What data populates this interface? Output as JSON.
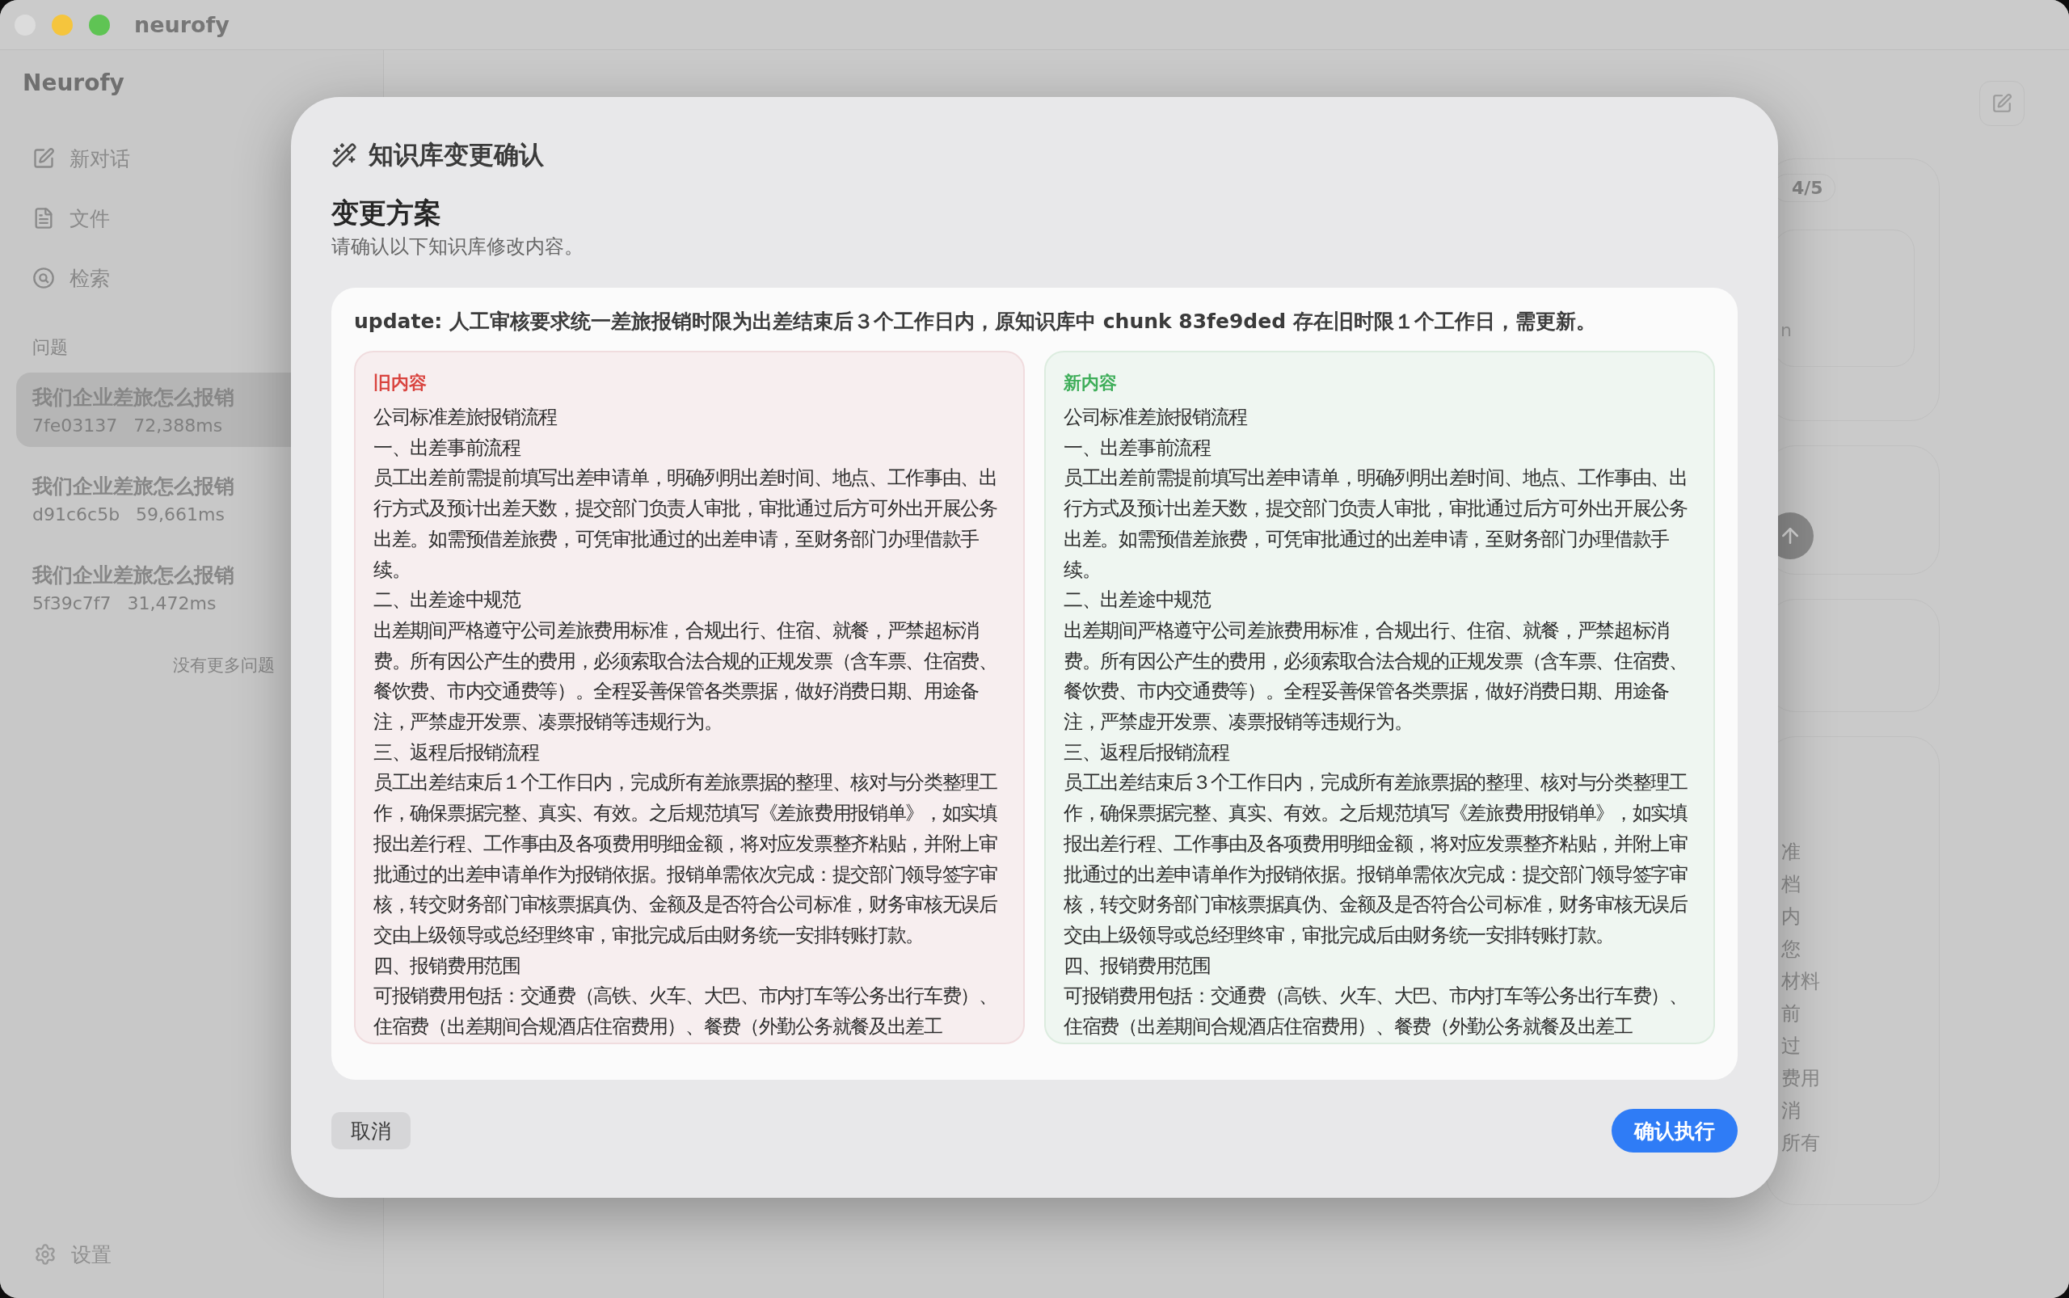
{
  "window": {
    "title": "neurofy"
  },
  "sidebar": {
    "brand": "Neurofy",
    "nav": [
      {
        "label": "新对话"
      },
      {
        "label": "文件"
      },
      {
        "label": "检索"
      }
    ],
    "section_label": "问题",
    "questions": [
      {
        "title": "我们企业差旅怎么报销",
        "id": "7fe03137",
        "duration": "72,388ms",
        "selected": true
      },
      {
        "title": "我们企业差旅怎么报销",
        "id": "d91c6c5b",
        "duration": "59,661ms",
        "selected": false
      },
      {
        "title": "我们企业差旅怎么报销",
        "id": "5f39c7f7",
        "duration": "31,472ms",
        "selected": false
      }
    ],
    "end_note": "没有更多问题",
    "settings": "设置"
  },
  "background": {
    "badge": "4/5",
    "card_fragment": "n",
    "text_fragments": [
      "准",
      "档",
      "内",
      "您",
      "材料",
      "前",
      "过",
      "费用",
      "消",
      "所有"
    ]
  },
  "dialog": {
    "title": "知识库变更确认",
    "heading": "变更方案",
    "subtitle": "请确认以下知识库修改内容。",
    "summary": "update: 人工审核要求统一差旅报销时限为出差结束后３个工作日内，原知识库中 chunk 83fe9ded 存在旧时限１个工作日，需更新。",
    "panels": [
      {
        "kind": "old",
        "label": "旧内容",
        "paragraphs": [
          "公司标准差旅报销流程",
          "一、出差事前流程",
          "员工出差前需提前填写出差申请单，明确列明出差时间、地点、工作事由、出行方式及预计出差天数，提交部门负责人审批，审批通过后方可外出开展公务出差。如需预借差旅费，可凭审批通过的出差申请，至财务部门办理借款手续。",
          "二、出差途中规范",
          "出差期间严格遵守公司差旅费用标准，合规出行、住宿、就餐，严禁超标消费。所有因公产生的费用，必须索取合法合规的正规发票（含车票、住宿费、餐饮费、市内交通费等）。全程妥善保管各类票据，做好消费日期、用途备注，严禁虚开发票、凑票报销等违规行为。",
          "三、返程后报销流程",
          "员工出差结束后１个工作日内，完成所有差旅票据的整理、核对与分类整理工作，确保票据完整、真实、有效。之后规范填写《差旅费用报销单》，如实填报出差行程、工作事由及各项费用明细金额，将对应发票整齐粘贴，并附上审批通过的出差申请单作为报销依据。报销单需依次完成：提交部门领导签字审核，转交财务部门审核票据真伪、金额及是否符合公司标准，财务审核无误后交由上级领导或总经理终审，审批完成后由财务统一安排转账打款。",
          "四、报销费用范围",
          "可报销费用包括：交通费（高铁、火车、大巴、市内打车等公务出行车费）、住宿费（出差期间合规酒店住宿费用）、餐费（外勤公务就餐及出差工"
        ]
      },
      {
        "kind": "new",
        "label": "新内容",
        "paragraphs": [
          "公司标准差旅报销流程",
          "一、出差事前流程",
          "员工出差前需提前填写出差申请单，明确列明出差时间、地点、工作事由、出行方式及预计出差天数，提交部门负责人审批，审批通过后方可外出开展公务出差。如需预借差旅费，可凭审批通过的出差申请，至财务部门办理借款手续。",
          "二、出差途中规范",
          "出差期间严格遵守公司差旅费用标准，合规出行、住宿、就餐，严禁超标消费。所有因公产生的费用，必须索取合法合规的正规发票（含车票、住宿费、餐饮费、市内交通费等）。全程妥善保管各类票据，做好消费日期、用途备注，严禁虚开发票、凑票报销等违规行为。",
          "三、返程后报销流程",
          "员工出差结束后３个工作日内，完成所有差旅票据的整理、核对与分类整理工作，确保票据完整、真实、有效。之后规范填写《差旅费用报销单》，如实填报出差行程、工作事由及各项费用明细金额，将对应发票整齐粘贴，并附上审批通过的出差申请单作为报销依据。报销单需依次完成：提交部门领导签字审核，转交财务部门审核票据真伪、金额及是否符合公司标准，财务审核无误后交由上级领导或总经理终审，审批完成后由财务统一安排转账打款。",
          "四、报销费用范围",
          "可报销费用包括：交通费（高铁、火车、大巴、市内打车等公务出行车费）、住宿费（出差期间合规酒店住宿费用）、餐费（外勤公务就餐及出差工"
        ]
      }
    ],
    "buttons": [
      {
        "kind": "secondary",
        "label": "取消"
      },
      {
        "kind": "primary",
        "label": "确认执行"
      }
    ]
  }
}
